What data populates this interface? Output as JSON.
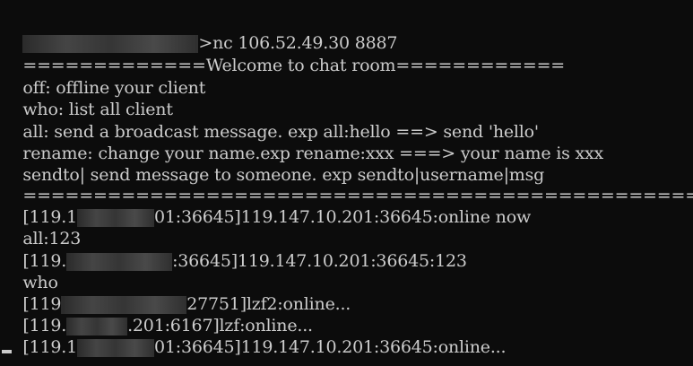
{
  "terminal": {
    "background": "#0c0c0c",
    "foreground": "#cccccc",
    "lines": [
      {
        "pre": "",
        "post": ">nc 106.52.49.30 8887",
        "redacted": true
      },
      {
        "pre": "=============Welcome to chat room============",
        "post": "",
        "redacted": false
      },
      {
        "pre": "off: offline your client",
        "post": "",
        "redacted": false
      },
      {
        "pre": "who: list all client",
        "post": "",
        "redacted": false
      },
      {
        "pre": "all: send a broadcast message. exp all:hello ==> send 'hello'",
        "post": "",
        "redacted": false
      },
      {
        "pre": "rename: change your name.exp rename:xxx ===> your name is xxx",
        "post": "",
        "redacted": false
      },
      {
        "pre": "sendto| send message to someone. exp sendto|username|msg",
        "post": "",
        "redacted": false
      },
      {
        "pre": "===========================================================",
        "post": "",
        "redacted": false
      },
      {
        "pre": "[119.1",
        "post": "01:36645]119.147.10.201:36645:online now",
        "redacted": true
      },
      {
        "pre": "all:123",
        "post": "",
        "redacted": false
      },
      {
        "pre": "[119.",
        "post": ":36645]119.147.10.201:36645:123",
        "redacted": true
      },
      {
        "pre": "who",
        "post": "",
        "redacted": false
      },
      {
        "pre": "[119",
        "post": "27751]lzf2:online...",
        "redacted": true
      },
      {
        "pre": "[119.",
        "post": ".201:6167]lzf:online...",
        "redacted": true
      },
      {
        "pre": "[119.1",
        "post": "01:36645]119.147.10.201:36645:online...",
        "redacted": true
      }
    ]
  }
}
